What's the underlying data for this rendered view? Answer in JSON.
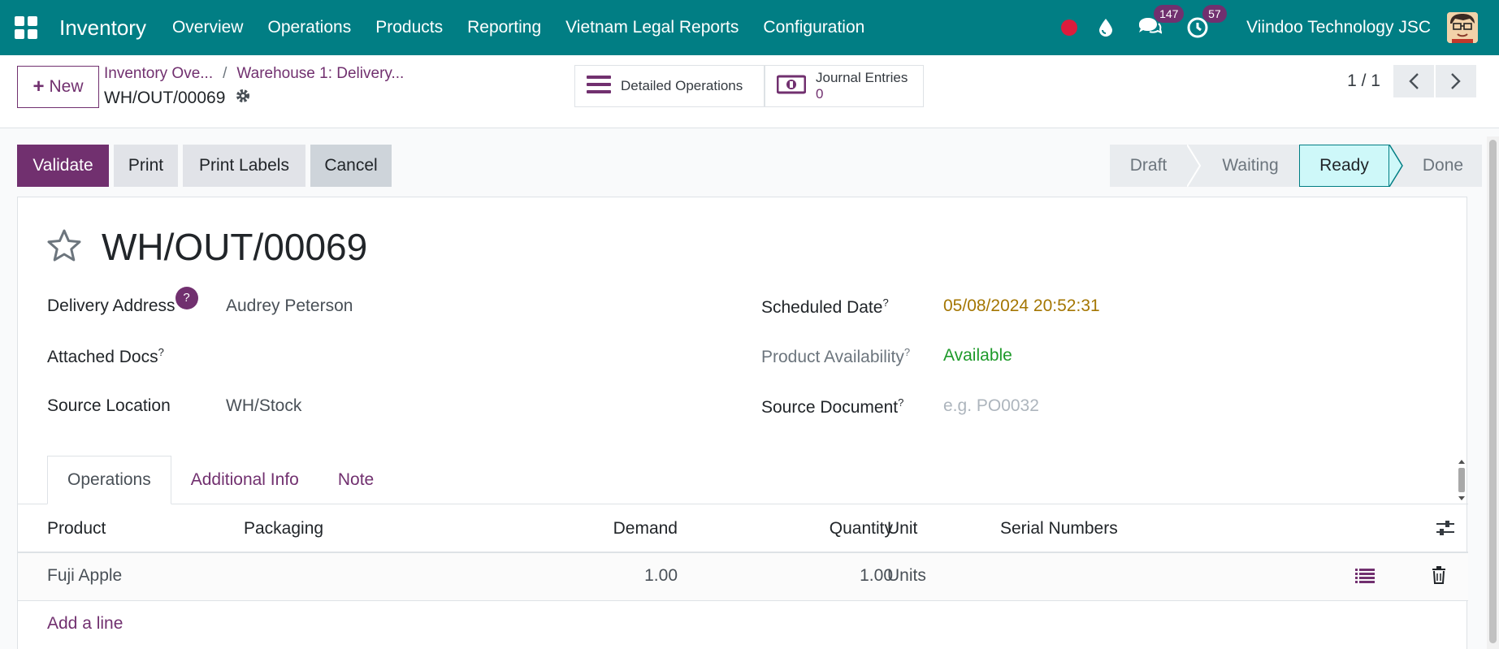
{
  "navbar": {
    "app_name": "Inventory",
    "menu": [
      "Overview",
      "Operations",
      "Products",
      "Reporting",
      "Vietnam Legal Reports",
      "Configuration"
    ],
    "messages_count": "147",
    "activities_count": "57",
    "company": "Viindoo Technology JSC",
    "color": "#017e84"
  },
  "control": {
    "new_label": "New",
    "breadcrumb_1": "Inventory Ove...",
    "breadcrumb_2": "Warehouse 1: Delivery...",
    "separator": "/",
    "record": "WH/OUT/00069",
    "smart_detailed": "Detailed Operations",
    "smart_journal_label": "Journal Entries",
    "smart_journal_value": "0",
    "pager": "1 / 1"
  },
  "actions": {
    "validate": "Validate",
    "print": "Print",
    "print_labels": "Print Labels",
    "cancel": "Cancel"
  },
  "status": [
    "Draft",
    "Waiting",
    "Ready",
    "Done"
  ],
  "status_active": "Ready",
  "form": {
    "title": "WH/OUT/00069",
    "delivery_address_label": "Delivery Address",
    "delivery_address_help": "?",
    "delivery_address": "Audrey Peterson",
    "attached_docs_label": "Attached Docs",
    "source_location_label": "Source Location",
    "source_location": "WH/Stock",
    "scheduled_date_label": "Scheduled Date",
    "scheduled_date": "05/08/2024 20:52:31",
    "availability_label": "Product Availability",
    "availability": "Available",
    "source_document_label": "Source Document",
    "source_document_placeholder": "e.g. PO0032",
    "help_mark": "?"
  },
  "tabs": [
    "Operations",
    "Additional Info",
    "Note"
  ],
  "table": {
    "headers": [
      "Product",
      "Packaging",
      "Demand",
      "Quantity",
      "Unit",
      "Serial Numbers"
    ],
    "rows": [
      {
        "product": "Fuji Apple",
        "packaging": "",
        "demand": "1.00",
        "quantity": "1.00",
        "unit": "Units",
        "serials": ""
      }
    ],
    "add_line": "Add a line"
  }
}
